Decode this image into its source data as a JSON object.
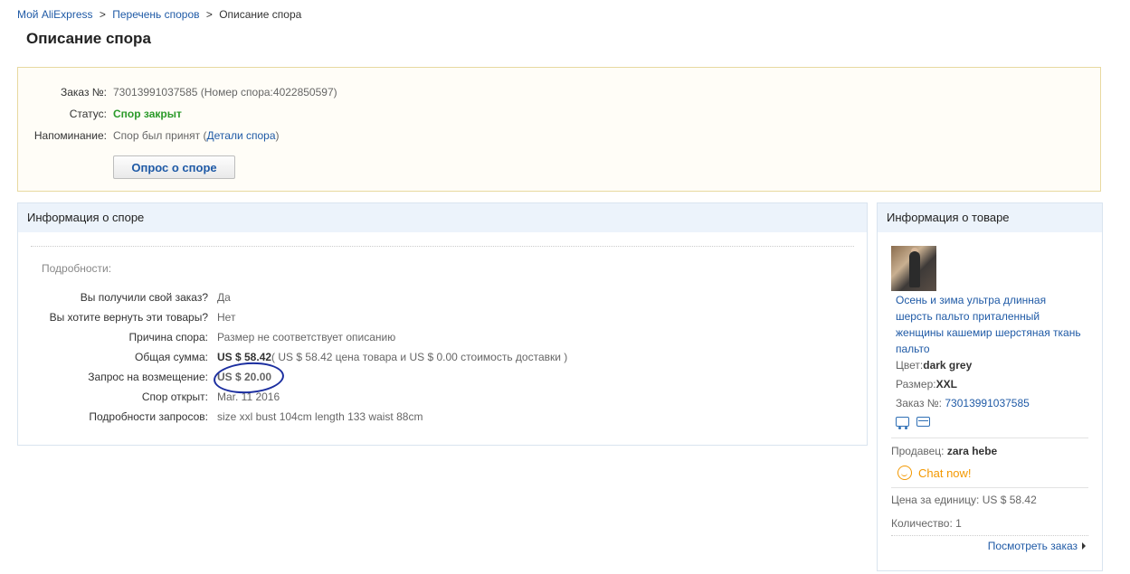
{
  "breadcrumb": {
    "item1": "Мой AliExpress",
    "sep": ">",
    "item2": "Перечень споров",
    "current": "Описание спора"
  },
  "page_title": "Описание спора",
  "status": {
    "order_label": "Заказ №:",
    "order_value": "73013991037585 (Номер спора:4022850597)",
    "status_label": "Статус:",
    "status_value": "Спор закрыт",
    "reminder_label": "Напоминание:",
    "reminder_text": "Спор был принят",
    "reminder_open": "(",
    "reminder_link": "Детали спора",
    "reminder_close": ")",
    "survey_button": "Опрос о споре"
  },
  "dispute": {
    "header": "Информация о споре",
    "details_title": "Подробности:",
    "rows": [
      {
        "label": "Вы получили свой заказ?",
        "value": "Да"
      },
      {
        "label": "Вы хотите вернуть эти товары?",
        "value": "Нет"
      },
      {
        "label": "Причина спора:",
        "value": "Размер не соответствует описанию"
      },
      {
        "label": "Общая сумма:",
        "value": "US $ 58.42",
        "extra": "( US $ 58.42 цена товара и US $ 0.00 стоимость доставки )"
      },
      {
        "label": "Запрос на возмещение:",
        "value": "US $ 20.00"
      },
      {
        "label": "Спор открыт:",
        "value": "Mar. 11 2016"
      },
      {
        "label": "Подробности запросов:",
        "value": "size xxl bust 104cm length 133 waist 88cm"
      }
    ]
  },
  "product": {
    "header": "Информация о товаре",
    "title": "Осень и зима ультра длинная шерсть пальто приталенный женщины кашемир шерстяная ткань пальто",
    "color_label": "Цвет:",
    "color_value": "dark grey",
    "size_label": "Размер:",
    "size_value": "XXL",
    "order_label": "Заказ №:",
    "order_value": "73013991037585",
    "seller_label": "Продавец:",
    "seller_value": "zara hebe",
    "chat_label": "Chat now!",
    "unit_price_label": "Цена за единицу:",
    "unit_price_value": "US $ 58.42",
    "qty_label": "Количество:",
    "qty_value": "1",
    "view_order": "Посмотреть заказ"
  },
  "colors": {
    "link": "#1f5aa6",
    "status_closed": "#2a9a2a",
    "refund": "#f07800",
    "chat": "#f39800",
    "panel_header_bg": "#ecf3fb"
  },
  "icons": [
    "shipping-icon",
    "payment-card-icon",
    "chat-smile-icon",
    "arrow-right-icon"
  ]
}
